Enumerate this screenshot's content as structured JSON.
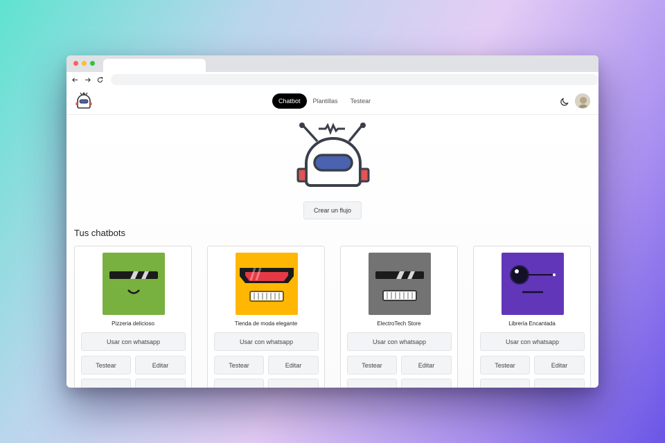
{
  "browser": {
    "tab_title": "",
    "url": ""
  },
  "nav": {
    "links": [
      {
        "label": "Chatbot",
        "active": true
      },
      {
        "label": "Plantillas",
        "active": false
      },
      {
        "label": "Testear",
        "active": false
      }
    ],
    "theme_icon": "moon-icon",
    "avatar_icon": "user-avatar"
  },
  "hero": {
    "icon": "robot-logo",
    "create_button": "Crear un flujo"
  },
  "section": {
    "title": "Tus chatbots"
  },
  "chatbots": [
    {
      "name": "Pizzeria delicioso",
      "color": "#78b13f",
      "buttons": {
        "whatsapp": "Usar con whatsapp",
        "test": "Testear",
        "edit": "Editar",
        "third": "",
        "fourth": ""
      }
    },
    {
      "name": "Tienda de moda elegante",
      "color": "#ffb703",
      "buttons": {
        "whatsapp": "Usar con whatsapp",
        "test": "Testear",
        "edit": "Editar",
        "third": "",
        "fourth": ""
      }
    },
    {
      "name": "ElectroTech Store",
      "color": "#737373",
      "buttons": {
        "whatsapp": "Usar con whatsapp",
        "test": "Testear",
        "edit": "Editar",
        "third": "",
        "fourth": ""
      }
    },
    {
      "name": "Librería Encantada",
      "color": "#6236b8",
      "buttons": {
        "whatsapp": "Usar con whatsapp",
        "test": "Testear",
        "edit": "Editar",
        "third": "",
        "fourth": ""
      }
    }
  ],
  "colors": {
    "accent": "#000000",
    "robot_visor": "#4a62b0",
    "robot_ears": "#e05555"
  }
}
